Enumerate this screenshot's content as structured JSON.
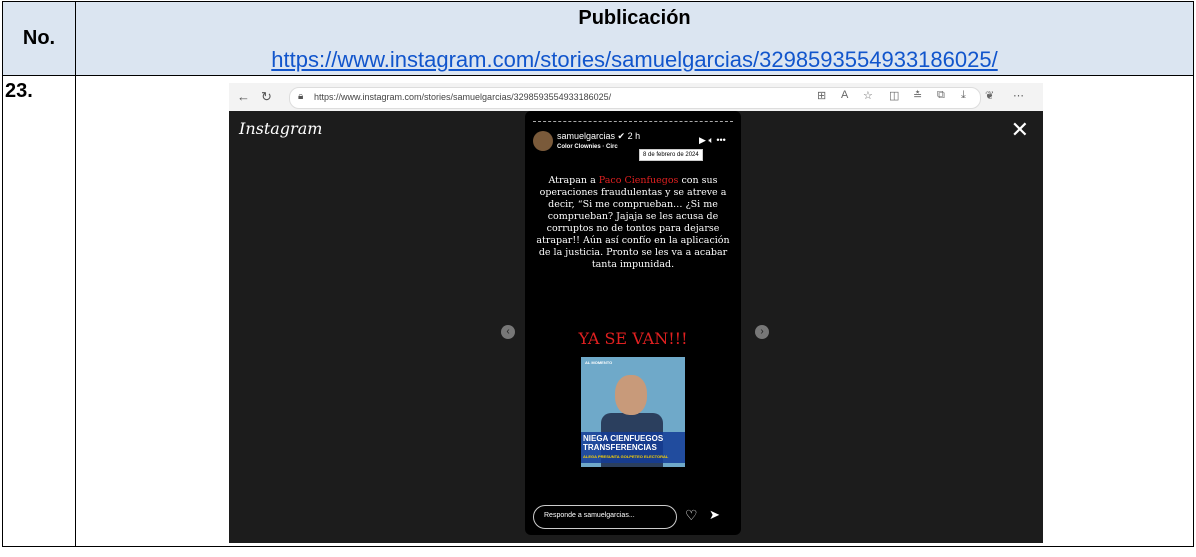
{
  "table": {
    "header_no": "No.",
    "header_publicacion": "Publicación",
    "link": "https://www.instagram.com/stories/samuelgarcias/3298593554933186025/",
    "row_number": "23."
  },
  "browser": {
    "url": "https://www.instagram.com/stories/samuelgarcias/3298593554933186025/"
  },
  "instagram": {
    "logo": "Instagram",
    "username": "samuelgarcias",
    "time_ago": "2 h",
    "music": "Color Clownies · Circ",
    "tooltip_date": "8 de febrero de 2024",
    "caption_before": "Atrapan a ",
    "caption_name": "Paco Cienfuegos",
    "caption_after": " con sus operaciones fraudulentas y se atreve a decir, “Si me comprueban… ¿Si me comprueban? Jajaja se les acusa de corruptos no de tontos para dejarse atrapar!! Aún así confío en la aplicación de la justicia. Pronto se les va a acabar tanta impunidad.",
    "highlight": "YA SE VAN!!!",
    "thumb_tag": "AL MOMENTO",
    "thumb_headline": "NIEGA CIENFUEGOS TRANSFERENCIAS",
    "thumb_sub": "ALEGA PRESUNTA GOLPETEO ELECTORAL",
    "reply_placeholder": "Responde a samuelgarcias..."
  },
  "icons": [
    "back-arrow-icon",
    "refresh-icon",
    "lock-icon",
    "close-icon",
    "heart-icon",
    "send-icon",
    "play-icon",
    "volume-icon",
    "more-icon",
    "chevron-left-icon",
    "chevron-right-icon"
  ],
  "colors": {
    "header_bg": "#dbe5f1",
    "link": "#1155cc",
    "accent_red": "#e02020"
  }
}
